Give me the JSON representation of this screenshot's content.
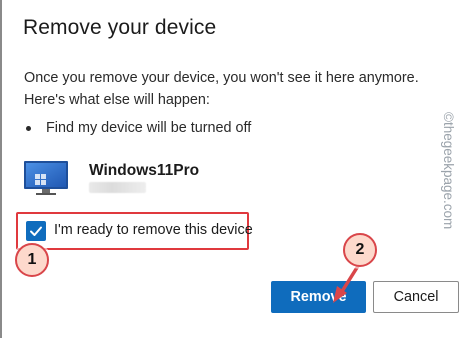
{
  "dialog": {
    "title": "Remove your device",
    "description": "Once you remove your device, you won't see it here anymore. Here's what else will happen:",
    "bullets": [
      "Find my device will be turned off"
    ],
    "device": {
      "name": "Windows11Pro",
      "icon": "monitor-icon",
      "subtitle_blurred": "████████"
    },
    "confirm_checkbox": {
      "label": "I'm ready to remove this device",
      "checked": true
    },
    "buttons": {
      "remove": "Remove",
      "cancel": "Cancel"
    }
  },
  "annotations": {
    "callout_1": "1",
    "callout_2": "2",
    "color": "#d9464a"
  },
  "watermark": "©thegeekpage.com",
  "colors": {
    "primary": "#0f6cbd",
    "highlight": "#e0393e"
  }
}
